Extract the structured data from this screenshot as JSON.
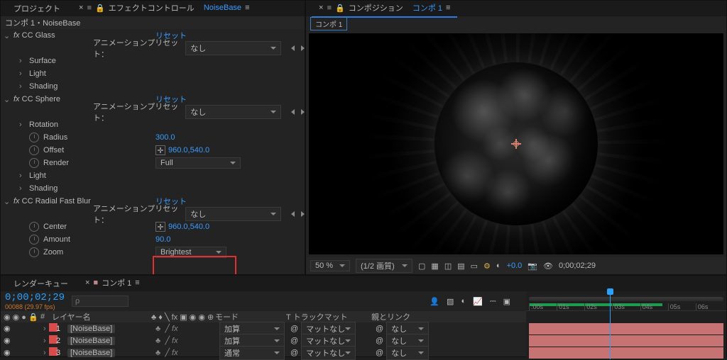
{
  "header": {
    "project_tab": "プロジェクト",
    "effect_controls_label": "エフェクトコントロール",
    "effect_controls_target": "NoiseBase",
    "close_x": "×",
    "menu_glyph": "≡",
    "lock_glyph": "🔒",
    "breadcrumb": "コンポ 1・NoiseBase",
    "comp_panel_label": "コンポジション",
    "comp_name": "コンポ 1",
    "comp_breadcrumb": "コンポ 1"
  },
  "effects": {
    "cc_glass": {
      "name": "CC Glass",
      "reset": "リセット",
      "preset_label": "アニメーションプリセット：",
      "preset_value": "なし",
      "sub": [
        "Surface",
        "Light",
        "Shading"
      ]
    },
    "cc_sphere": {
      "name": "CC Sphere",
      "reset": "リセット",
      "preset_label": "アニメーションプリセット：",
      "preset_value": "なし",
      "rotation_label": "Rotation",
      "radius_label": "Radius",
      "radius_value": "300.0",
      "offset_label": "Offset",
      "offset_value": "960.0,540.0",
      "render_label": "Render",
      "render_value": "Full",
      "light_label": "Light",
      "shading_label": "Shading"
    },
    "cc_rfb": {
      "name": "CC Radial Fast Blur",
      "reset": "リセット",
      "preset_label": "アニメーションプリセット：",
      "preset_value": "なし",
      "center_label": "Center",
      "center_value": "960.0,540.0",
      "amount_label": "Amount",
      "amount_value": "90.0",
      "zoom_label": "Zoom",
      "zoom_value": "Brightest"
    }
  },
  "viewer": {
    "zoom": "50 %",
    "quality": "(1/2 画質)",
    "exposure": "+0.0",
    "timecode": "0;00;02;29"
  },
  "timeline": {
    "render_tab": "レンダーキュー",
    "comp_tab": "コンポ 1",
    "close_x": "×",
    "menu_glyph": "≡",
    "timecode": "0;00;02;29",
    "frame_info": "00088 (29.97 fps)",
    "search_placeholder": "ρ",
    "cols": {
      "num": "#",
      "name": "レイヤー名",
      "mode": "モード",
      "track": "T トラックマット",
      "parent": "親とリンク"
    },
    "layers": [
      {
        "num": "1",
        "name": "[NoiseBase]",
        "mode": "加算",
        "track": "マットなし",
        "parent": "なし"
      },
      {
        "num": "2",
        "name": "[NoiseBase]",
        "mode": "加算",
        "track": "マットなし",
        "parent": "なし"
      },
      {
        "num": "3",
        "name": "[NoiseBase]",
        "mode": "通常",
        "track": "マットなし",
        "parent": "なし"
      }
    ],
    "ruler": [
      ":00s",
      "01s",
      "02s",
      "03s",
      "04s",
      "05s",
      "06s"
    ]
  },
  "glyph": {
    "twirl_closed": "›",
    "twirl_open": "⌄",
    "square": "■",
    "eye": "◉",
    "none_twirl": "›",
    "pickwhip": "@"
  }
}
